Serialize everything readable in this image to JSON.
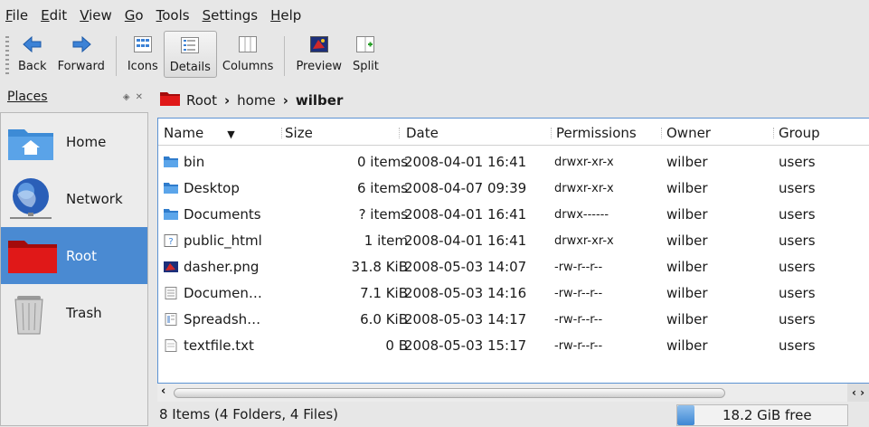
{
  "menubar": {
    "items": [
      {
        "u": "F",
        "rest": "ile"
      },
      {
        "u": "E",
        "rest": "dit"
      },
      {
        "u": "V",
        "rest": "iew"
      },
      {
        "u": "G",
        "rest": "o"
      },
      {
        "u": "T",
        "rest": "ools"
      },
      {
        "u": "S",
        "rest": "ettings"
      },
      {
        "u": "H",
        "rest": "elp"
      }
    ]
  },
  "toolbar": {
    "back": "Back",
    "forward": "Forward",
    "icons": "Icons",
    "details": "Details",
    "columns": "Columns",
    "preview": "Preview",
    "split": "Split"
  },
  "places": {
    "title": "Places",
    "items": [
      {
        "label": "Home",
        "icon": "home-icon"
      },
      {
        "label": "Network",
        "icon": "network-icon"
      },
      {
        "label": "Root",
        "icon": "root-folder-icon",
        "selected": true
      },
      {
        "label": "Trash",
        "icon": "trash-icon"
      }
    ]
  },
  "breadcrumb": {
    "items": [
      "Root",
      "home"
    ],
    "current": "wilber",
    "separator": "›"
  },
  "columns": {
    "name": "Name",
    "size": "Size",
    "date": "Date",
    "permissions": "Permissions",
    "owner": "Owner",
    "group": "Group"
  },
  "files": [
    {
      "icon": "folder-icon",
      "name": "bin",
      "size": "0 items",
      "date": "2008-04-01 16:41",
      "permissions": "drwxr-xr-x",
      "owner": "wilber",
      "group": "users"
    },
    {
      "icon": "folder-icon",
      "name": "Desktop",
      "size": "6 items",
      "date": "2008-04-07 09:39",
      "permissions": "drwxr-xr-x",
      "owner": "wilber",
      "group": "users"
    },
    {
      "icon": "folder-icon",
      "name": "Documents",
      "size": "? items",
      "date": "2008-04-01 16:41",
      "permissions": "drwx------",
      "owner": "wilber",
      "group": "users"
    },
    {
      "icon": "unknown-folder-icon",
      "name": "public_html",
      "size": "1 item",
      "date": "2008-04-01 16:41",
      "permissions": "drwxr-xr-x",
      "owner": "wilber",
      "group": "users"
    },
    {
      "icon": "image-icon",
      "name": "dasher.png",
      "size": "31.8 KiB",
      "date": "2008-05-03 14:07",
      "permissions": "-rw-r--r--",
      "owner": "wilber",
      "group": "users"
    },
    {
      "icon": "document-icon",
      "name": "Documen…",
      "size": "7.1 KiB",
      "date": "2008-05-03 14:16",
      "permissions": "-rw-r--r--",
      "owner": "wilber",
      "group": "users"
    },
    {
      "icon": "spreadsheet-icon",
      "name": "Spreadsh…",
      "size": "6.0 KiB",
      "date": "2008-05-03 14:17",
      "permissions": "-rw-r--r--",
      "owner": "wilber",
      "group": "users"
    },
    {
      "icon": "text-file-icon",
      "name": "textfile.txt",
      "size": "0 B",
      "date": "2008-05-03 15:17",
      "permissions": "-rw-r--r--",
      "owner": "wilber",
      "group": "users"
    }
  ],
  "status": {
    "summary": "8 Items (4 Folders, 4 Files)",
    "free_space": "18.2 GiB free",
    "used_fraction": 0.1
  },
  "colors": {
    "selection": "#4a8ad2",
    "folder": "#3d8bd6",
    "root_folder": "#d01010"
  }
}
